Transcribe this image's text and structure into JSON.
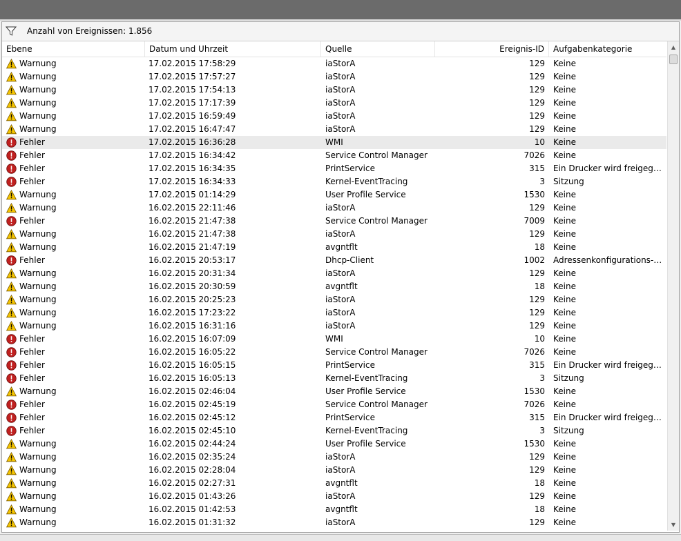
{
  "filter": {
    "icon": "filter-icon",
    "text": "Anzahl von Ereignissen: 1.856"
  },
  "columns": {
    "level": "Ebene",
    "date": "Datum und Uhrzeit",
    "source": "Quelle",
    "event_id": "Ereignis-ID",
    "category": "Aufgabenkategorie"
  },
  "icons": {
    "warning": "warning-icon",
    "error": "error-icon"
  },
  "colors": {
    "warning": "#f5c400",
    "error": "#c0201f",
    "selected_row": "#eaeaea"
  },
  "scrollbar": {
    "up": "▲",
    "down": "▼"
  },
  "selected_index": 6,
  "rows": [
    {
      "level": "Warnung",
      "date": "17.02.2015 17:58:29",
      "source": "iaStorA",
      "id": "129",
      "category": "Keine"
    },
    {
      "level": "Warnung",
      "date": "17.02.2015 17:57:27",
      "source": "iaStorA",
      "id": "129",
      "category": "Keine"
    },
    {
      "level": "Warnung",
      "date": "17.02.2015 17:54:13",
      "source": "iaStorA",
      "id": "129",
      "category": "Keine"
    },
    {
      "level": "Warnung",
      "date": "17.02.2015 17:17:39",
      "source": "iaStorA",
      "id": "129",
      "category": "Keine"
    },
    {
      "level": "Warnung",
      "date": "17.02.2015 16:59:49",
      "source": "iaStorA",
      "id": "129",
      "category": "Keine"
    },
    {
      "level": "Warnung",
      "date": "17.02.2015 16:47:47",
      "source": "iaStorA",
      "id": "129",
      "category": "Keine"
    },
    {
      "level": "Fehler",
      "date": "17.02.2015 16:36:28",
      "source": "WMI",
      "id": "10",
      "category": "Keine"
    },
    {
      "level": "Fehler",
      "date": "17.02.2015 16:34:42",
      "source": "Service Control Manager",
      "id": "7026",
      "category": "Keine"
    },
    {
      "level": "Fehler",
      "date": "17.02.2015 16:34:35",
      "source": "PrintService",
      "id": "315",
      "category": "Ein Drucker wird freigegeben"
    },
    {
      "level": "Fehler",
      "date": "17.02.2015 16:34:33",
      "source": "Kernel-EventTracing",
      "id": "3",
      "category": "Sitzung"
    },
    {
      "level": "Warnung",
      "date": "17.02.2015 01:14:29",
      "source": "User Profile Service",
      "id": "1530",
      "category": "Keine"
    },
    {
      "level": "Warnung",
      "date": "16.02.2015 22:11:46",
      "source": "iaStorA",
      "id": "129",
      "category": "Keine"
    },
    {
      "level": "Fehler",
      "date": "16.02.2015 21:47:38",
      "source": "Service Control Manager",
      "id": "7009",
      "category": "Keine"
    },
    {
      "level": "Warnung",
      "date": "16.02.2015 21:47:38",
      "source": "iaStorA",
      "id": "129",
      "category": "Keine"
    },
    {
      "level": "Warnung",
      "date": "16.02.2015 21:47:19",
      "source": "avgntflt",
      "id": "18",
      "category": "Keine"
    },
    {
      "level": "Fehler",
      "date": "16.02.2015 20:53:17",
      "source": "Dhcp-Client",
      "id": "1002",
      "category": "Adressenkonfigurations-Sta..."
    },
    {
      "level": "Warnung",
      "date": "16.02.2015 20:31:34",
      "source": "iaStorA",
      "id": "129",
      "category": "Keine"
    },
    {
      "level": "Warnung",
      "date": "16.02.2015 20:30:59",
      "source": "avgntflt",
      "id": "18",
      "category": "Keine"
    },
    {
      "level": "Warnung",
      "date": "16.02.2015 20:25:23",
      "source": "iaStorA",
      "id": "129",
      "category": "Keine"
    },
    {
      "level": "Warnung",
      "date": "16.02.2015 17:23:22",
      "source": "iaStorA",
      "id": "129",
      "category": "Keine"
    },
    {
      "level": "Warnung",
      "date": "16.02.2015 16:31:16",
      "source": "iaStorA",
      "id": "129",
      "category": "Keine"
    },
    {
      "level": "Fehler",
      "date": "16.02.2015 16:07:09",
      "source": "WMI",
      "id": "10",
      "category": "Keine"
    },
    {
      "level": "Fehler",
      "date": "16.02.2015 16:05:22",
      "source": "Service Control Manager",
      "id": "7026",
      "category": "Keine"
    },
    {
      "level": "Fehler",
      "date": "16.02.2015 16:05:15",
      "source": "PrintService",
      "id": "315",
      "category": "Ein Drucker wird freigegeben"
    },
    {
      "level": "Fehler",
      "date": "16.02.2015 16:05:13",
      "source": "Kernel-EventTracing",
      "id": "3",
      "category": "Sitzung"
    },
    {
      "level": "Warnung",
      "date": "16.02.2015 02:46:04",
      "source": "User Profile Service",
      "id": "1530",
      "category": "Keine"
    },
    {
      "level": "Fehler",
      "date": "16.02.2015 02:45:19",
      "source": "Service Control Manager",
      "id": "7026",
      "category": "Keine"
    },
    {
      "level": "Fehler",
      "date": "16.02.2015 02:45:12",
      "source": "PrintService",
      "id": "315",
      "category": "Ein Drucker wird freigegeben"
    },
    {
      "level": "Fehler",
      "date": "16.02.2015 02:45:10",
      "source": "Kernel-EventTracing",
      "id": "3",
      "category": "Sitzung"
    },
    {
      "level": "Warnung",
      "date": "16.02.2015 02:44:24",
      "source": "User Profile Service",
      "id": "1530",
      "category": "Keine"
    },
    {
      "level": "Warnung",
      "date": "16.02.2015 02:35:24",
      "source": "iaStorA",
      "id": "129",
      "category": "Keine"
    },
    {
      "level": "Warnung",
      "date": "16.02.2015 02:28:04",
      "source": "iaStorA",
      "id": "129",
      "category": "Keine"
    },
    {
      "level": "Warnung",
      "date": "16.02.2015 02:27:31",
      "source": "avgntflt",
      "id": "18",
      "category": "Keine"
    },
    {
      "level": "Warnung",
      "date": "16.02.2015 01:43:26",
      "source": "iaStorA",
      "id": "129",
      "category": "Keine"
    },
    {
      "level": "Warnung",
      "date": "16.02.2015 01:42:53",
      "source": "avgntflt",
      "id": "18",
      "category": "Keine"
    },
    {
      "level": "Warnung",
      "date": "16.02.2015 01:31:32",
      "source": "iaStorA",
      "id": "129",
      "category": "Keine"
    }
  ]
}
